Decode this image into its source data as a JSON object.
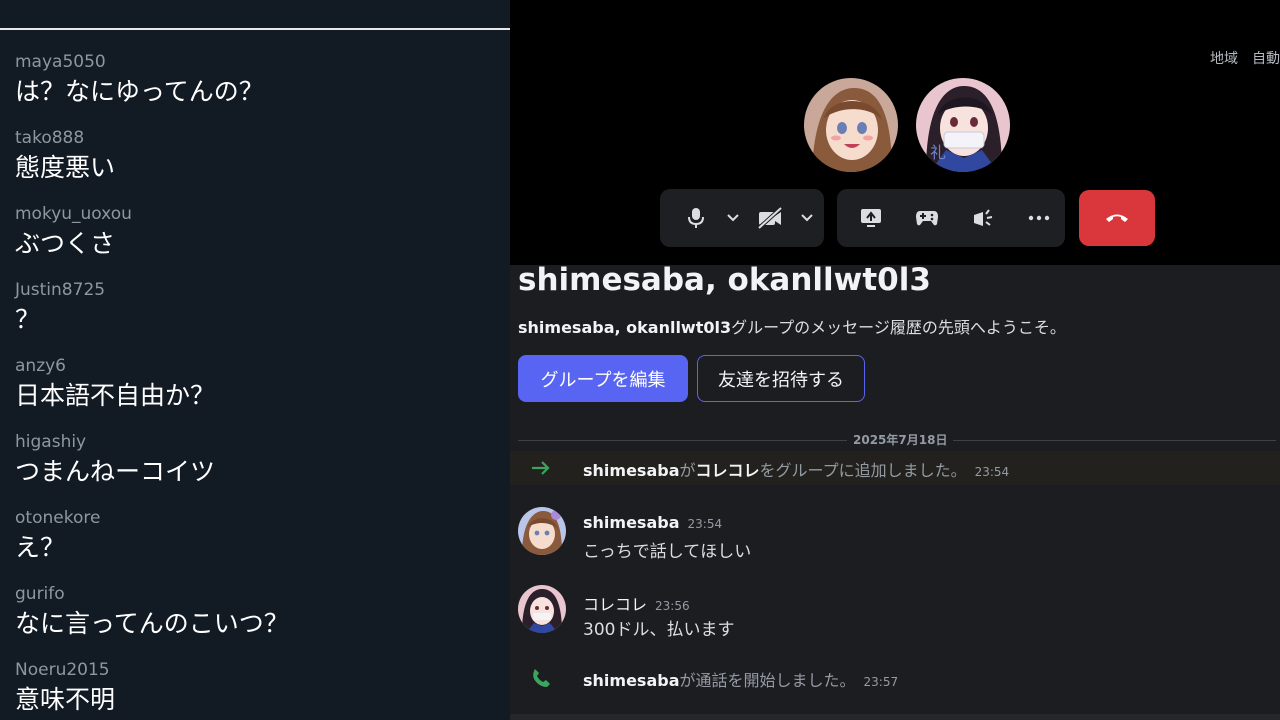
{
  "live_chat": {
    "messages": [
      {
        "user": "maya5050",
        "text": "は？なにゆってんの？"
      },
      {
        "user": "tako888",
        "text": "態度悪い"
      },
      {
        "user": "mokyu_uoxou",
        "text": "ぶつくさ"
      },
      {
        "user": "Justin8725",
        "text": "？"
      },
      {
        "user": "anzy6",
        "text": "日本語不自由か？"
      },
      {
        "user": "higashiy",
        "text": "つまんねーコイツ"
      },
      {
        "user": "otonekore",
        "text": "え？"
      },
      {
        "user": "gurifo",
        "text": "なに言ってんのこいつ？"
      },
      {
        "user": "Noeru2015",
        "text": "意味不明"
      }
    ]
  },
  "call": {
    "region_label": "地域",
    "region_value": "自動",
    "participants": [
      "shimesaba",
      "コレコレ"
    ],
    "controls": {
      "mic": "microphone-icon",
      "camera": "camera-off-icon",
      "screen_share": "screen-share-icon",
      "activity": "gamepad-icon",
      "soundboard": "soundboard-icon",
      "more": "more-icon",
      "hangup": "phone-hangup-icon"
    },
    "colors": {
      "hangup": "#da373c",
      "accent": "#5865f2"
    }
  },
  "group": {
    "title": "shimesaba, okanllwt0l3",
    "welcome_name": "shimesaba, okanllwt0l3",
    "welcome_suffix": "グループのメッセージ履歴の先頭へようこそ。",
    "edit_button": "グループを編集",
    "invite_button": "友達を招待する"
  },
  "messages": {
    "date_divider": "2025年7月18日",
    "system_add": {
      "actor": "shimesaba",
      "particle": "が",
      "target": "コレコレ",
      "rest": "をグループに追加しました。",
      "time": "23:54"
    },
    "items": [
      {
        "author": "shimesaba",
        "time": "23:54",
        "text": "こっちで話してほしい"
      },
      {
        "author": "コレコレ",
        "time": "23:56",
        "text": "300ドル、払います"
      }
    ],
    "system_call": {
      "actor": "shimesaba",
      "rest": "が通話を開始しました。",
      "time": "23:57"
    }
  }
}
